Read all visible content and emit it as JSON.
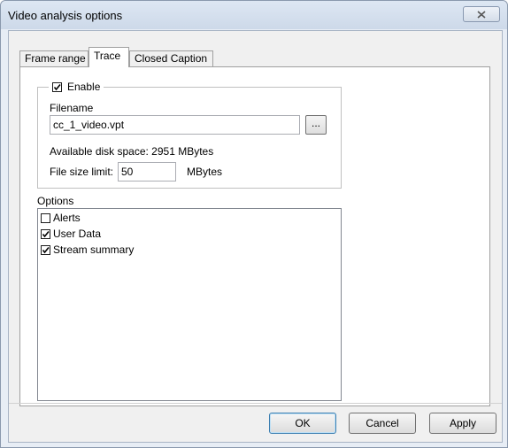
{
  "window": {
    "title": "Video analysis options"
  },
  "tabs": [
    {
      "label": "Frame range",
      "active": false
    },
    {
      "label": "Trace",
      "active": true
    },
    {
      "label": "Closed Caption",
      "active": false
    }
  ],
  "trace": {
    "enable": {
      "label": "Enable",
      "checked": true
    },
    "filename": {
      "label": "Filename",
      "value": "cc_1_video.vpt",
      "browse_label": "..."
    },
    "disk_space": "Available disk space: 2951 MBytes",
    "file_size": {
      "label": "File size limit:",
      "value": "50",
      "unit": "MBytes"
    }
  },
  "options": {
    "label": "Options",
    "items": [
      {
        "label": "Alerts",
        "checked": false
      },
      {
        "label": "User Data",
        "checked": true
      },
      {
        "label": "Stream summary",
        "checked": true
      }
    ]
  },
  "buttons": {
    "ok": "OK",
    "cancel": "Cancel",
    "apply": "Apply"
  }
}
